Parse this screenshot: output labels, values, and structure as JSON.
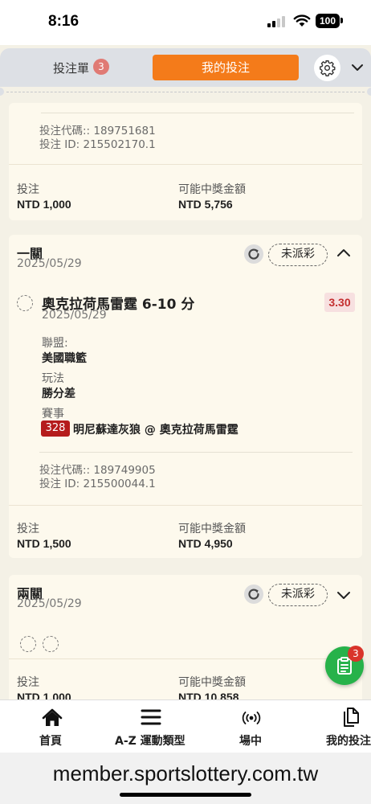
{
  "status_bar": {
    "time": "8:16",
    "battery": "100"
  },
  "toolbar": {
    "betslip_label": "投注單",
    "betslip_count": "3",
    "mybets_label": "我的投注"
  },
  "card_top": {
    "bet_code_line": "投注代碼:: 189751681",
    "bet_id_line": "投注 ID: 215502170.1",
    "stake_label": "投注",
    "stake_value": "NTD 1,000",
    "payout_label": "可能中獎金額",
    "payout_value": "NTD 5,756"
  },
  "card_single": {
    "type": "一關",
    "date": "2025/05/29",
    "status": "未派彩",
    "selection": {
      "title": "奧克拉荷馬雷霆 6-10 分",
      "date": "2025/05/29",
      "odds": "3.30",
      "league_label": "聯盟:",
      "league_value": "美國職籃",
      "market_label": "玩法",
      "market_value": "勝分差",
      "event_label": "賽事",
      "event_code": "328",
      "event_name": "明尼蘇達灰狼 @ 奧克拉荷馬雷霆"
    },
    "bet_code_line": "投注代碼:: 189749905",
    "bet_id_line": "投注 ID: 215500044.1",
    "stake_label": "投注",
    "stake_value": "NTD 1,500",
    "payout_label": "可能中獎金額",
    "payout_value": "NTD 4,950"
  },
  "card_double": {
    "type": "兩關",
    "date": "2025/05/29",
    "status": "未派彩",
    "stake_label": "投注",
    "stake_value": "NTD 1,000",
    "payout_label": "可能中獎金額",
    "payout_value": "NTD 10,858"
  },
  "fab": {
    "badge": "3"
  },
  "nav": [
    {
      "label": "首頁",
      "icon": "home-icon"
    },
    {
      "label": "A-Z 運動類型",
      "icon": "menu-icon"
    },
    {
      "label": "場中",
      "icon": "live-broadcast-icon"
    },
    {
      "label": "我的投注",
      "icon": "copy-documents-icon"
    }
  ],
  "browser": {
    "url": "member.sportslottery.com.tw"
  },
  "colors": {
    "accent": "#f47b1a",
    "card_bg": "#fdf9ed",
    "page_bg": "#f4f1e6",
    "odds_red": "#c42f2f",
    "fab_green": "#27b24a"
  }
}
